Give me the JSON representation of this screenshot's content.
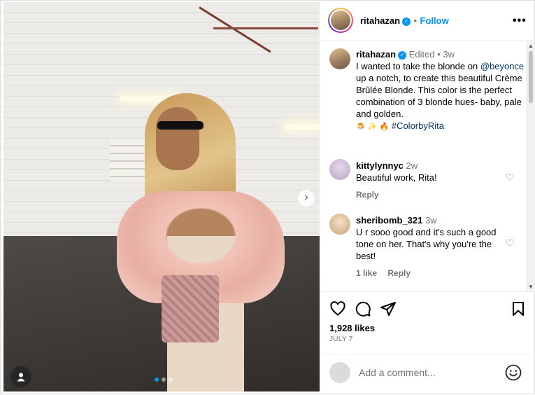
{
  "header": {
    "username": "ritahazan",
    "verified_mark": "✓",
    "separator": "•",
    "follow_label": "Follow",
    "more_label": "•••"
  },
  "caption": {
    "username": "ritahazan",
    "edited_label": "Edited",
    "separator": "•",
    "age": "3w",
    "text_before_mention": "I wanted to take the blonde on ",
    "mention": "@beyonce",
    "text_after_mention": " up a notch, to create this beautiful Crème Brûlée Blonde. This color is the perfect combination of 3 blonde hues- baby, pale and golden.",
    "emojis": "🍮 ✨ 🔥",
    "hashtag": "#ColorbyRita"
  },
  "comments": [
    {
      "username": "kittylynnyc",
      "age": "2w",
      "text": "Beautiful work, Rita!",
      "likes_label": "",
      "reply_label": "Reply"
    },
    {
      "username": "sheribomb_321",
      "age": "3w",
      "text": "U r sooo good and it's such a good tone on her. That's why you're the best!",
      "likes_label": "1 like",
      "reply_label": "Reply"
    }
  ],
  "actions": {
    "like_icon": "heart-icon",
    "comment_icon": "comment-icon",
    "share_icon": "share-icon",
    "save_icon": "bookmark-icon"
  },
  "likes_text": "1,928 likes",
  "date_text": "JULY 7",
  "add_comment": {
    "placeholder": "Add a comment..."
  },
  "media": {
    "slide_count": 3,
    "active_slide": 1,
    "next_icon": "›"
  },
  "colors": {
    "link": "#00376b",
    "accent": "#0095f6",
    "muted": "#737373"
  }
}
